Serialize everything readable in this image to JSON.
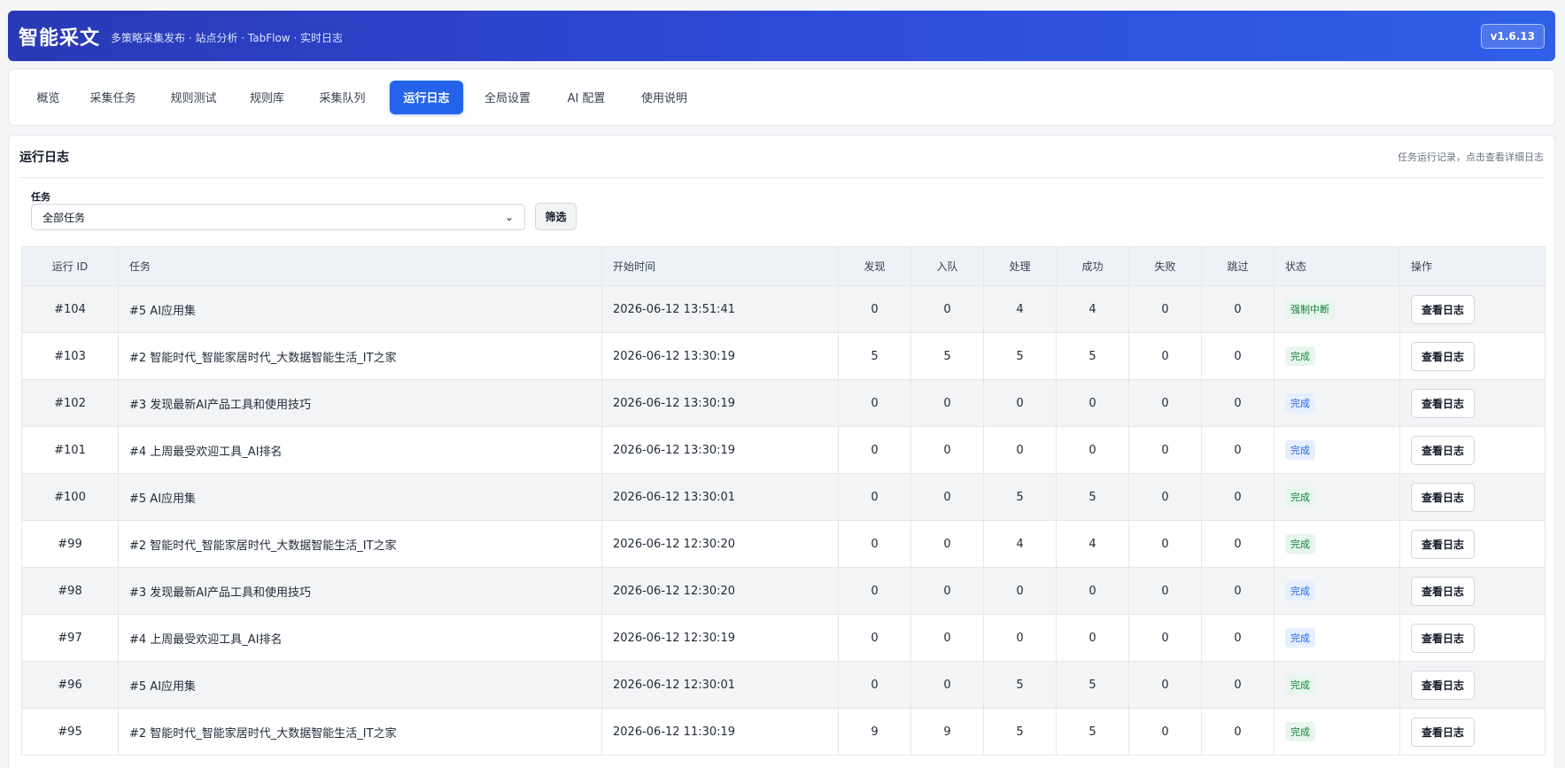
{
  "app": {
    "title": "智能采文",
    "subtitle": "多策略采集发布 · 站点分析 · TabFlow · 实时日志",
    "version": "v1.6.13"
  },
  "tabs": [
    {
      "label": "概览",
      "active": false
    },
    {
      "label": "采集任务",
      "active": false
    },
    {
      "label": "规则测试",
      "active": false
    },
    {
      "label": "规则库",
      "active": false
    },
    {
      "label": "采集队列",
      "active": false
    },
    {
      "label": "运行日志",
      "active": true
    },
    {
      "label": "全局设置",
      "active": false
    },
    {
      "label": "AI 配置",
      "active": false
    },
    {
      "label": "使用说明",
      "active": false
    }
  ],
  "panel": {
    "title": "运行日志",
    "hint": "任务运行记录，点击查看详细日志",
    "filter": {
      "label": "任务",
      "selected": "全部任务",
      "button": "筛选"
    }
  },
  "table": {
    "headers": [
      "运行 ID",
      "任务",
      "开始时间",
      "发现",
      "入队",
      "处理",
      "成功",
      "失败",
      "跳过",
      "状态",
      "操作"
    ],
    "action_label": "查看日志",
    "rows": [
      {
        "id": "#104",
        "task": "#5 AI应用集",
        "start": "2026-06-12 13:51:41",
        "found": "0",
        "queued": "0",
        "processed": "4",
        "success": "4",
        "failed": "0",
        "skipped": "0",
        "status": "强制中断",
        "status_color": "green"
      },
      {
        "id": "#103",
        "task": "#2 智能时代_智能家居时代_大数据智能生活_IT之家",
        "start": "2026-06-12 13:30:19",
        "found": "5",
        "queued": "5",
        "processed": "5",
        "success": "5",
        "failed": "0",
        "skipped": "0",
        "status": "完成",
        "status_color": "green"
      },
      {
        "id": "#102",
        "task": "#3 发现最新AI产品工具和使用技巧",
        "start": "2026-06-12 13:30:19",
        "found": "0",
        "queued": "0",
        "processed": "0",
        "success": "0",
        "failed": "0",
        "skipped": "0",
        "status": "完成",
        "status_color": "blue"
      },
      {
        "id": "#101",
        "task": "#4 上周最受欢迎工具_AI排名",
        "start": "2026-06-12 13:30:19",
        "found": "0",
        "queued": "0",
        "processed": "0",
        "success": "0",
        "failed": "0",
        "skipped": "0",
        "status": "完成",
        "status_color": "blue"
      },
      {
        "id": "#100",
        "task": "#5 AI应用集",
        "start": "2026-06-12 13:30:01",
        "found": "0",
        "queued": "0",
        "processed": "5",
        "success": "5",
        "failed": "0",
        "skipped": "0",
        "status": "完成",
        "status_color": "green"
      },
      {
        "id": "#99",
        "task": "#2 智能时代_智能家居时代_大数据智能生活_IT之家",
        "start": "2026-06-12 12:30:20",
        "found": "0",
        "queued": "0",
        "processed": "4",
        "success": "4",
        "failed": "0",
        "skipped": "0",
        "status": "完成",
        "status_color": "green"
      },
      {
        "id": "#98",
        "task": "#3 发现最新AI产品工具和使用技巧",
        "start": "2026-06-12 12:30:20",
        "found": "0",
        "queued": "0",
        "processed": "0",
        "success": "0",
        "failed": "0",
        "skipped": "0",
        "status": "完成",
        "status_color": "blue"
      },
      {
        "id": "#97",
        "task": "#4 上周最受欢迎工具_AI排名",
        "start": "2026-06-12 12:30:19",
        "found": "0",
        "queued": "0",
        "processed": "0",
        "success": "0",
        "failed": "0",
        "skipped": "0",
        "status": "完成",
        "status_color": "blue"
      },
      {
        "id": "#96",
        "task": "#5 AI应用集",
        "start": "2026-06-12 12:30:01",
        "found": "0",
        "queued": "0",
        "processed": "5",
        "success": "5",
        "failed": "0",
        "skipped": "0",
        "status": "完成",
        "status_color": "green"
      },
      {
        "id": "#95",
        "task": "#2 智能时代_智能家居时代_大数据智能生活_IT之家",
        "start": "2026-06-12 11:30:19",
        "found": "9",
        "queued": "9",
        "processed": "5",
        "success": "5",
        "failed": "0",
        "skipped": "0",
        "status": "完成",
        "status_color": "green"
      }
    ]
  }
}
